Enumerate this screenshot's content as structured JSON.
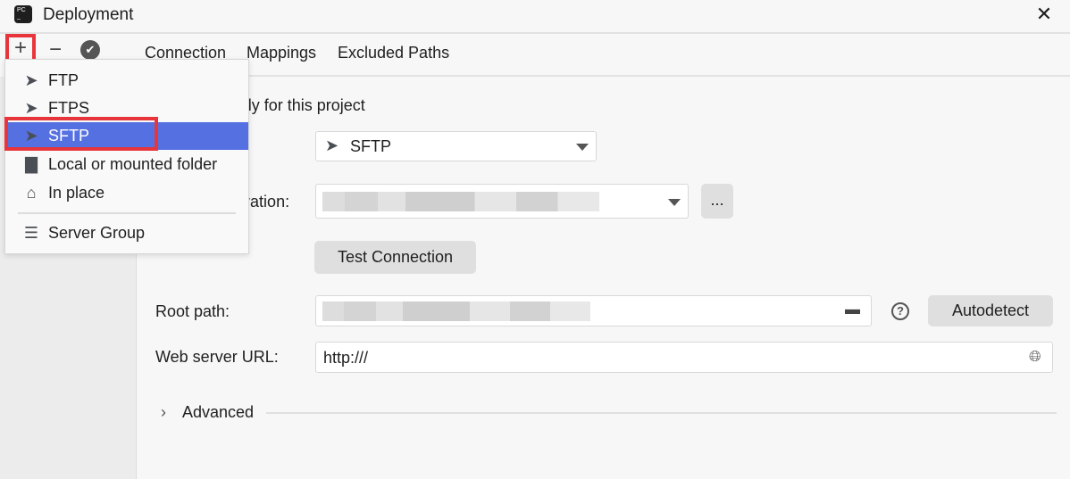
{
  "window": {
    "title": "Deployment",
    "close": "✕"
  },
  "toolbar": {
    "add": "+",
    "remove": "−",
    "default": "✔"
  },
  "tabs": [
    {
      "label": "Connection"
    },
    {
      "label": "Mappings"
    },
    {
      "label": "Excluded Paths"
    }
  ],
  "menu": {
    "items": [
      {
        "label": "FTP",
        "icon": "send-icon"
      },
      {
        "label": "FTPS",
        "icon": "send-lock-icon"
      },
      {
        "label": "SFTP",
        "icon": "send-lock-icon",
        "selected": true
      },
      {
        "label": "Local or mounted folder",
        "icon": "computer-icon"
      },
      {
        "label": "In place",
        "icon": "home-icon"
      },
      {
        "label": "Server Group",
        "icon": "server-group-icon"
      }
    ]
  },
  "form": {
    "visible_only": "Visible only for this project",
    "type_value": "SFTP",
    "ssh_label": "SSH configuration:",
    "browse": "...",
    "test_connection": "Test Connection",
    "root_path_label": "Root path:",
    "autodetect": "Autodetect",
    "web_url_label": "Web server URL:",
    "web_url_value": "http:///",
    "advanced": "Advanced"
  },
  "colors": {
    "selection": "#5570e0",
    "highlight": "#e8353b"
  }
}
